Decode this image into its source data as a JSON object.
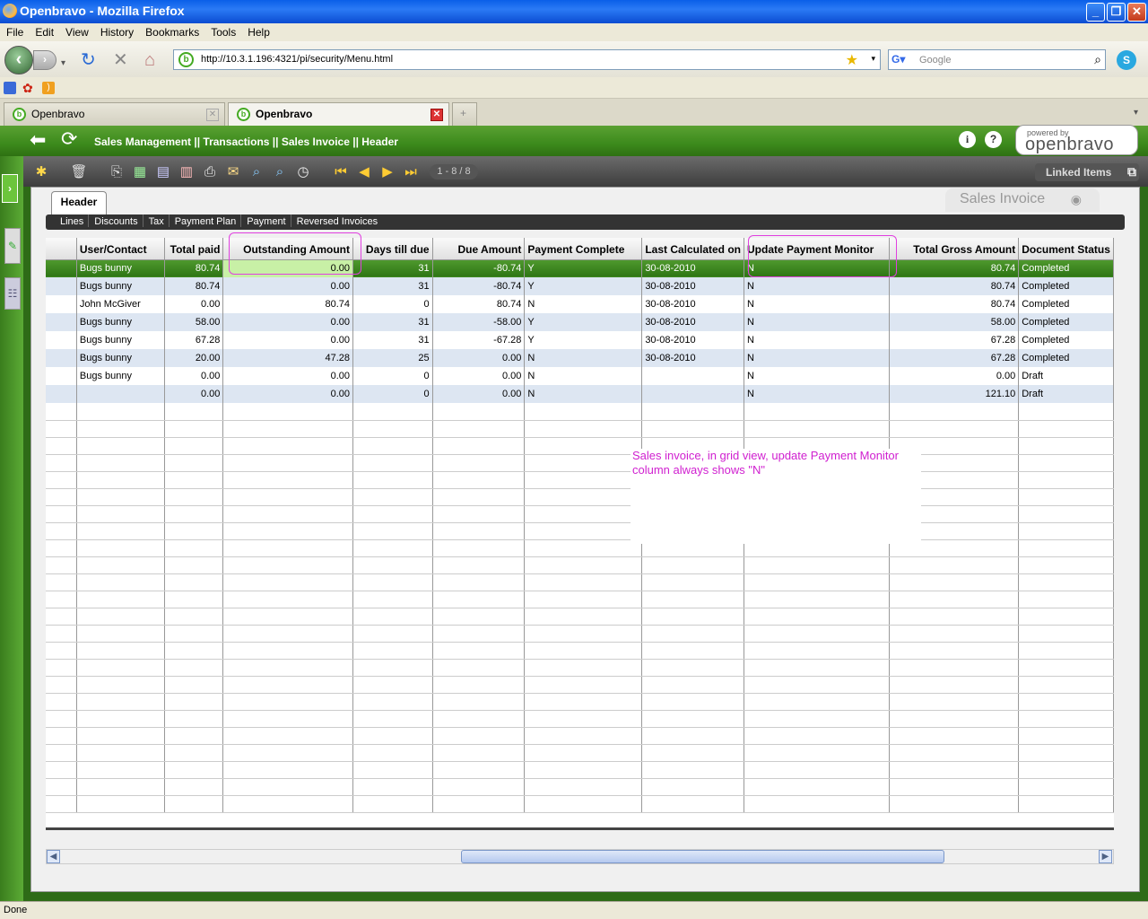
{
  "window": {
    "title": "Openbravo - Mozilla Firefox"
  },
  "menu": [
    "File",
    "Edit",
    "View",
    "History",
    "Bookmarks",
    "Tools",
    "Help"
  ],
  "address": {
    "url": "http://10.3.1.196:4321/pi/security/Menu.html"
  },
  "search": {
    "placeholder": "Google"
  },
  "tabs": [
    {
      "label": "Openbravo",
      "active": false
    },
    {
      "label": "Openbravo",
      "active": true
    }
  ],
  "app": {
    "breadcrumb": "Sales Management || Transactions || Sales Invoice || Header",
    "powered_by": "powered by",
    "logo_text": "openbravo",
    "pager": "1 - 8 / 8",
    "linked_items": "Linked Items",
    "window_name": "Sales Invoice",
    "header_tab": "Header",
    "subtabs": [
      "Lines",
      "Discounts",
      "Tax",
      "Payment Plan",
      "Payment",
      "Reversed Invoices"
    ]
  },
  "grid": {
    "columns": [
      "",
      "User/Contact",
      "Total paid",
      "Outstanding Amount",
      "Days till due",
      "Due Amount",
      "Payment Complete",
      "Last Calculated on",
      "Update Payment Monitor",
      "Total Gross Amount",
      "Document Status"
    ],
    "rows": [
      [
        "",
        "Bugs bunny",
        "80.74",
        "0.00",
        "31",
        "-80.74",
        "Y",
        "30-08-2010",
        "N",
        "80.74",
        "Completed"
      ],
      [
        "",
        "Bugs bunny",
        "80.74",
        "0.00",
        "31",
        "-80.74",
        "Y",
        "30-08-2010",
        "N",
        "80.74",
        "Completed"
      ],
      [
        "",
        "John McGiver",
        "0.00",
        "80.74",
        "0",
        "80.74",
        "N",
        "30-08-2010",
        "N",
        "80.74",
        "Completed"
      ],
      [
        "",
        "Bugs bunny",
        "58.00",
        "0.00",
        "31",
        "-58.00",
        "Y",
        "30-08-2010",
        "N",
        "58.00",
        "Completed"
      ],
      [
        "",
        "Bugs bunny",
        "67.28",
        "0.00",
        "31",
        "-67.28",
        "Y",
        "30-08-2010",
        "N",
        "67.28",
        "Completed"
      ],
      [
        "",
        "Bugs bunny",
        "20.00",
        "47.28",
        "25",
        "0.00",
        "N",
        "30-08-2010",
        "N",
        "67.28",
        "Completed"
      ],
      [
        "",
        "Bugs bunny",
        "0.00",
        "0.00",
        "0",
        "0.00",
        "N",
        "",
        "N",
        "0.00",
        "Draft"
      ],
      [
        "",
        "",
        "0.00",
        "0.00",
        "0",
        "0.00",
        "N",
        "",
        "N",
        "121.10",
        "Draft"
      ]
    ]
  },
  "annotation": {
    "note": "Sales invoice, in grid view, update Payment Monitor column always shows \"N\"",
    "color": "#D020D0"
  },
  "status": {
    "text": "Done"
  },
  "colors": {
    "selected_row": "#3C8A1C",
    "alt_row": "#DDE6F2",
    "brand_green": "#4A9A28"
  }
}
